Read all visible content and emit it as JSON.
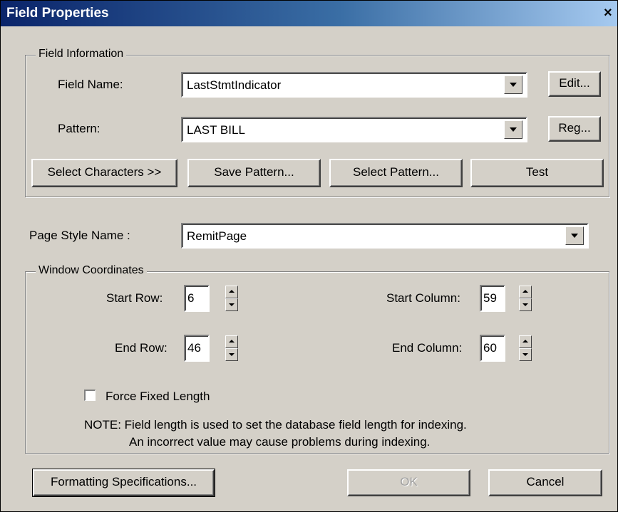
{
  "window": {
    "title": "Field Properties",
    "close_glyph": "×"
  },
  "field_info": {
    "group_label": "Field Information",
    "field_name_label": "Field Name:",
    "field_name_value": "LastStmtIndicator",
    "edit_label": "Edit...",
    "pattern_label": "Pattern:",
    "pattern_value": "LAST BILL",
    "reg_label": "Reg...",
    "buttons": {
      "select_characters": "Select Characters >>",
      "save_pattern": "Save Pattern...",
      "select_pattern": "Select Pattern...",
      "test": "Test"
    }
  },
  "page_style": {
    "label": "Page Style Name :",
    "value": "RemitPage"
  },
  "window_coords": {
    "group_label": "Window Coordinates",
    "start_row_label": "Start Row:",
    "start_row_value": "6",
    "end_row_label": "End Row:",
    "end_row_value": "46",
    "start_col_label": "Start Column:",
    "start_col_value": "59",
    "end_col_label": "End Column:",
    "end_col_value": "60",
    "force_fixed_label": "Force Fixed Length",
    "force_fixed_checked": false,
    "note_line1": "NOTE:  Field length is used to set the database field length for indexing.",
    "note_line2": "An incorrect value may cause problems during indexing."
  },
  "footer": {
    "formatting_label": "Formatting Specifications...",
    "ok_label": "OK",
    "cancel_label": "Cancel"
  }
}
